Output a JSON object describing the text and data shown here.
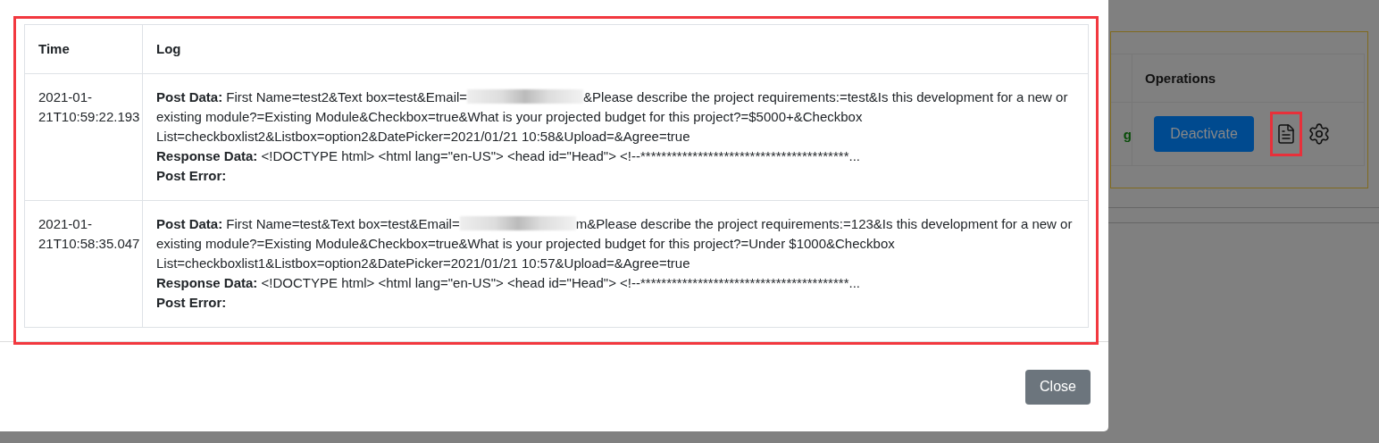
{
  "background": {
    "table": {
      "columns": [
        "Operations"
      ],
      "status_text": "g",
      "deactivate_button": "Deactivate"
    }
  },
  "modal": {
    "table": {
      "columns": [
        "Time",
        "Log"
      ],
      "rows": [
        {
          "time": "2021-01-21T10:59:22.193",
          "post_data_label": "Post Data:",
          "post_data_before": "First Name=test2&Text box=test&Email=",
          "post_data_after": "&Please describe the project requirements:=test&Is this development for a new or existing module?=Existing Module&Checkbox=true&What is your projected budget for this project?=$5000+&Checkbox List=checkboxlist2&Listbox=option2&DatePicker=2021/01/21 10:58&Upload=&Agree=true",
          "response_label": "Response Data:",
          "response_data": "<!DOCTYPE html> <html lang=\"en-US\"> <head id=\"Head\"> <!--****************************************...",
          "error_label": "Post Error:"
        },
        {
          "time": "2021-01-21T10:58:35.047",
          "post_data_label": "Post Data:",
          "post_data_before": "First Name=test&Text box=test&Email=",
          "post_data_after": "m&Please describe the project requirements:=123&Is this development for a new or existing module?=Existing Module&Checkbox=true&What is your projected budget for this project?=Under $1000&Checkbox List=checkboxlist1&Listbox=option2&DatePicker=2021/01/21 10:57&Upload=&Agree=true",
          "response_label": "Response Data:",
          "response_data": "<!DOCTYPE html> <html lang=\"en-US\"> <head id=\"Head\"> <!--****************************************...",
          "error_label": "Post Error:"
        }
      ]
    },
    "close_button": "Close"
  }
}
